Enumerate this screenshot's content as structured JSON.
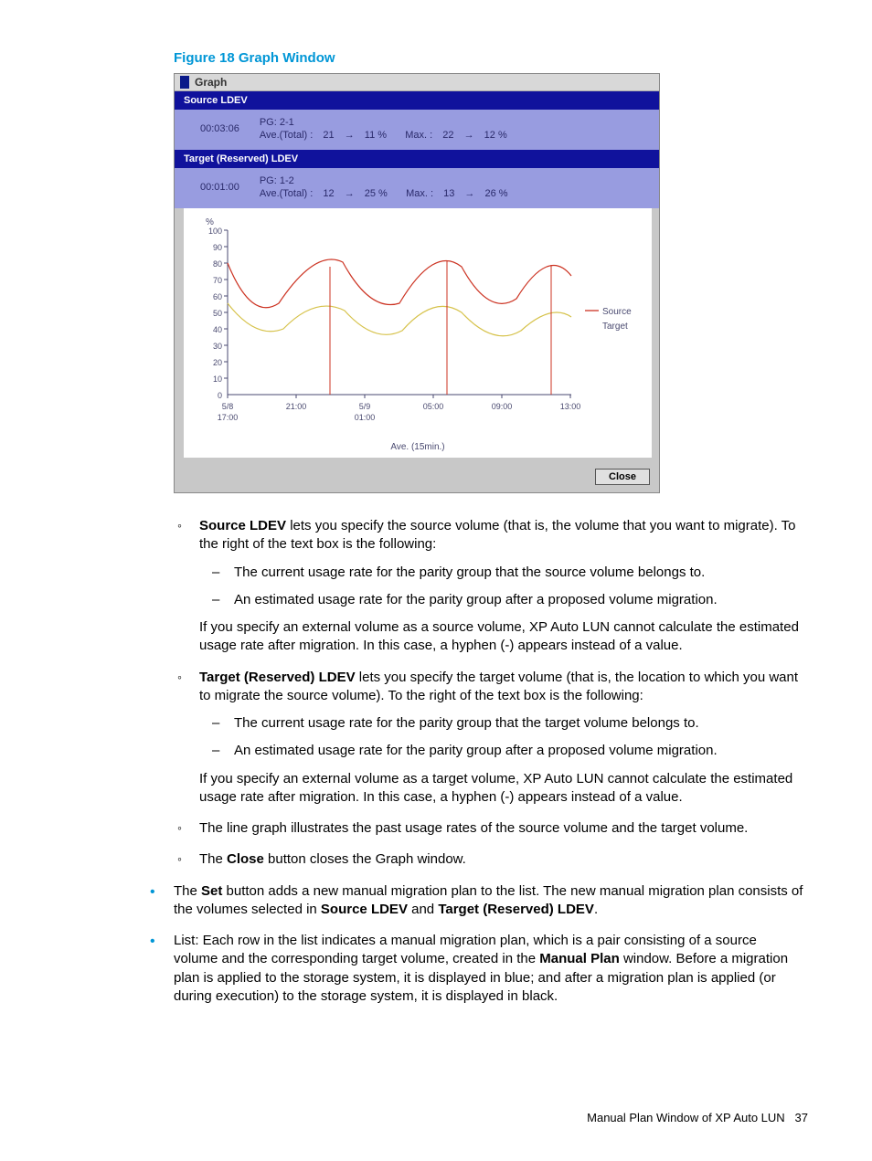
{
  "figure_title": "Figure 18 Graph Window",
  "window": {
    "title": "Graph",
    "source_header": "Source LDEV",
    "source": {
      "time": "00:03:06",
      "pg": "PG: 2-1",
      "ave_label": "Ave.(Total) :",
      "ave_from": "21",
      "ave_to": "11 %",
      "max_label": "Max. :",
      "max_from": "22",
      "max_to": "12 %"
    },
    "target_header": "Target (Reserved) LDEV",
    "target": {
      "time": "00:01:00",
      "pg": "PG: 1-2",
      "ave_label": "Ave.(Total) :",
      "ave_from": "12",
      "ave_to": "25 %",
      "max_label": "Max. :",
      "max_from": "13",
      "max_to": "26 %"
    },
    "chart_xlabel": "Ave. (15min.)",
    "legend_source": "Source",
    "legend_target": "Target",
    "close": "Close"
  },
  "chart_data": {
    "type": "line",
    "ylabel": "%",
    "ylim": [
      0,
      100
    ],
    "yticks": [
      0,
      10,
      20,
      30,
      40,
      50,
      60,
      70,
      80,
      90,
      100
    ],
    "xticks": [
      "5/8 17:00",
      "21:00",
      "5/9 01:00",
      "05:00",
      "09:00",
      "13:00"
    ],
    "xlabel": "Ave. (15min.)",
    "series": [
      {
        "name": "Source",
        "color": "#cc3322",
        "values": [
          80,
          48,
          62,
          88,
          56,
          58,
          90,
          60,
          52,
          88,
          70,
          50,
          72
        ]
      },
      {
        "name": "Target",
        "color": "#d6c24a",
        "values": [
          55,
          40,
          46,
          58,
          38,
          44,
          60,
          42,
          38,
          58,
          48,
          34,
          50
        ]
      }
    ]
  },
  "text": {
    "b1a": "Source LDEV",
    "b1b": " lets you specify the source volume (that is, the volume that you want to migrate). To the right of the text box is the following:",
    "b1d1": "The current usage rate for the parity group that the source volume belongs to.",
    "b1d2": "An estimated usage rate for the parity group after a proposed volume migration.",
    "b1p": "If you specify an external volume as a source volume, XP Auto LUN cannot calculate the estimated usage rate after migration. In this case, a hyphen (-) appears instead of a value.",
    "b2a": "Target (Reserved) LDEV",
    "b2b": " lets you specify the target volume (that is, the location to which you want to migrate the source volume). To the right of the text box is the following:",
    "b2d1": "The current usage rate for the parity group that the target volume belongs to.",
    "b2d2": "An estimated usage rate for the parity group after a proposed volume migration.",
    "b2p": "If you specify an external volume as a target volume, XP Auto LUN cannot calculate the estimated usage rate after migration. In this case, a hyphen (-) appears instead of a value.",
    "b3": "The line graph illustrates the past usage rates of the source volume and the target volume.",
    "b4a": "The ",
    "b4b": "Close",
    "b4c": " button closes the Graph window.",
    "d1a": "The ",
    "d1b": "Set",
    "d1c": " button adds a new manual migration plan to the list. The new manual migration plan consists of the volumes selected in ",
    "d1d": "Source LDEV",
    "d1e": " and ",
    "d1f": "Target (Reserved) LDEV",
    "d1g": ".",
    "d2a": "List: Each row in the list indicates a manual migration plan, which is a pair consisting of a source volume and the corresponding target volume, created in the ",
    "d2b": "Manual Plan",
    "d2c": " window. Before a migration plan is applied to the storage system, it is displayed in blue; and after a migration plan is applied (or during execution) to the storage system, it is displayed in black."
  },
  "footer": {
    "text": "Manual Plan Window of XP Auto LUN",
    "page": "37"
  }
}
